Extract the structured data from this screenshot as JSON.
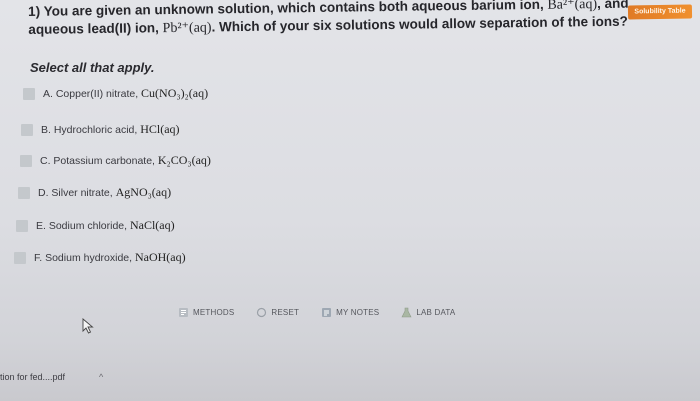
{
  "header": {
    "solubility_tab": "Solubility Table"
  },
  "question": {
    "number": "1)",
    "text_part1": "You are given an unknown solution, which contains both aqueous barium ion, ",
    "barium_formula": "Ba²⁺(aq)",
    "text_part2": ", and aqueous lead(II) ion, ",
    "lead_formula": "Pb²⁺(aq)",
    "text_part3": ". Which of your six solutions would allow separation of the ions?"
  },
  "instruction": "Select all that apply.",
  "options": [
    {
      "label": "A. Copper(II) nitrate, ",
      "formula": "Cu(NO₃)₂(aq)"
    },
    {
      "label": "B. Hydrochloric acid, ",
      "formula": "HCl(aq)"
    },
    {
      "label": "C. Potassium carbonate, ",
      "formula": "K₂CO₃(aq)"
    },
    {
      "label": "D. Silver nitrate, ",
      "formula": "AgNO₃(aq)"
    },
    {
      "label": "E. Sodium chloride, ",
      "formula": "NaCl(aq)"
    },
    {
      "label": "F. Sodium hydroxide, ",
      "formula": "NaOH(aq)"
    }
  ],
  "toolbar": {
    "methods": "METHODS",
    "reset": "RESET",
    "my_notes": "MY NOTES",
    "lab_data": "LAB DATA"
  },
  "download": {
    "filename": "tion for fed....pdf",
    "chevron": "^"
  },
  "colors": {
    "accent_tab": "#e88a2a",
    "checkbox": "#c4c8cc",
    "background": "#dcdde2"
  }
}
